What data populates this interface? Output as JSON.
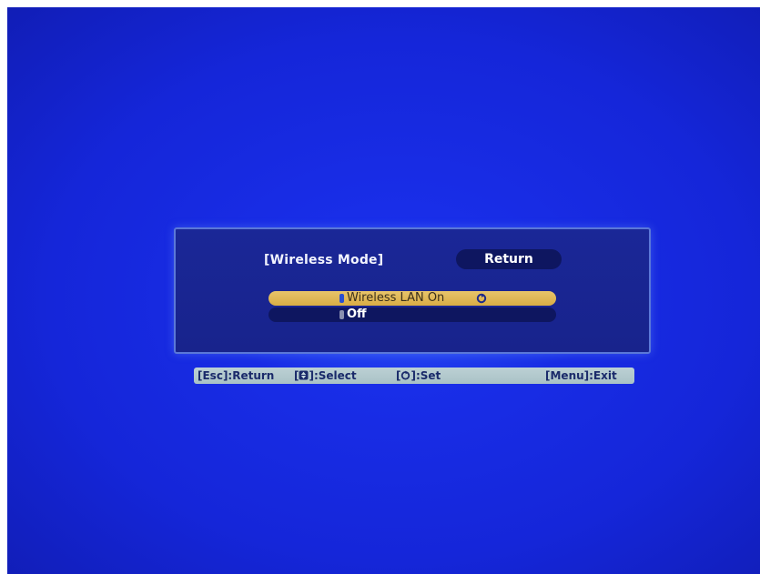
{
  "dialog": {
    "title": "[Wireless Mode]",
    "return_label": "Return",
    "options": [
      {
        "label": "Wireless LAN On",
        "selected": true,
        "icon": "set-icon"
      },
      {
        "label": "Off",
        "selected": false
      }
    ]
  },
  "help_bar": {
    "esc_return": "[Esc]:Return",
    "select_prefix": "[",
    "select_icon": "up-down-arrow-icon",
    "select_suffix": "]:Select",
    "set_prefix": "[",
    "set_icon": "enter-icon",
    "set_suffix": "]:Set",
    "menu_exit": "[Menu]:Exit"
  },
  "colors": {
    "background": "#1526d9",
    "panel": "#18238c",
    "highlight": "#e0b85a",
    "help_bar": "#b3c9cd"
  }
}
